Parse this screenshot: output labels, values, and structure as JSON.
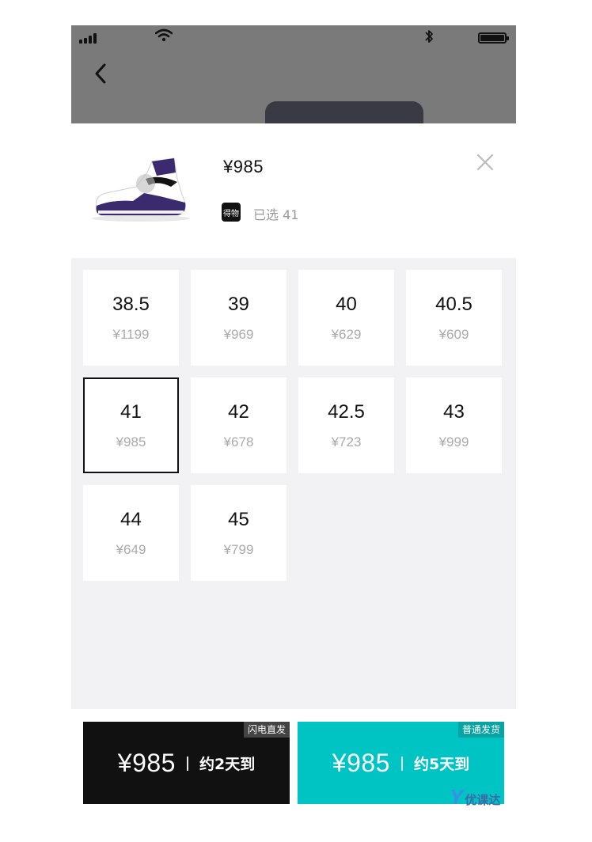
{
  "status_bar": {
    "icons": [
      "signal-icon",
      "wifi-icon",
      "bluetooth-icon",
      "battery-icon"
    ]
  },
  "header": {
    "back_icon": "chevron-left-icon"
  },
  "product": {
    "price": "¥985",
    "brand_badge": "得物",
    "selected_label": "已选 41",
    "close_icon": "close-icon"
  },
  "sizes": [
    {
      "size": "38.5",
      "price": "¥1199",
      "selected": false
    },
    {
      "size": "39",
      "price": "¥969",
      "selected": false
    },
    {
      "size": "40",
      "price": "¥629",
      "selected": false
    },
    {
      "size": "40.5",
      "price": "¥609",
      "selected": false
    },
    {
      "size": "41",
      "price": "¥985",
      "selected": true
    },
    {
      "size": "42",
      "price": "¥678",
      "selected": false
    },
    {
      "size": "42.5",
      "price": "¥723",
      "selected": false
    },
    {
      "size": "43",
      "price": "¥999",
      "selected": false
    },
    {
      "size": "44",
      "price": "¥649",
      "selected": false
    },
    {
      "size": "45",
      "price": "¥799",
      "selected": false
    }
  ],
  "buy_buttons": {
    "fast": {
      "tag": "闪电直发",
      "price": "¥985",
      "eta": "约2天到",
      "color": "#111111"
    },
    "normal": {
      "tag": "普通发货",
      "price": "¥985",
      "eta": "约5天到",
      "color": "#00c3c3"
    }
  },
  "watermark": {
    "logo": "Y",
    "text": "优课达"
  },
  "colors": {
    "accent_teal": "#00c3c3",
    "selected_border": "#111111",
    "grid_background": "#f2f2f4"
  }
}
